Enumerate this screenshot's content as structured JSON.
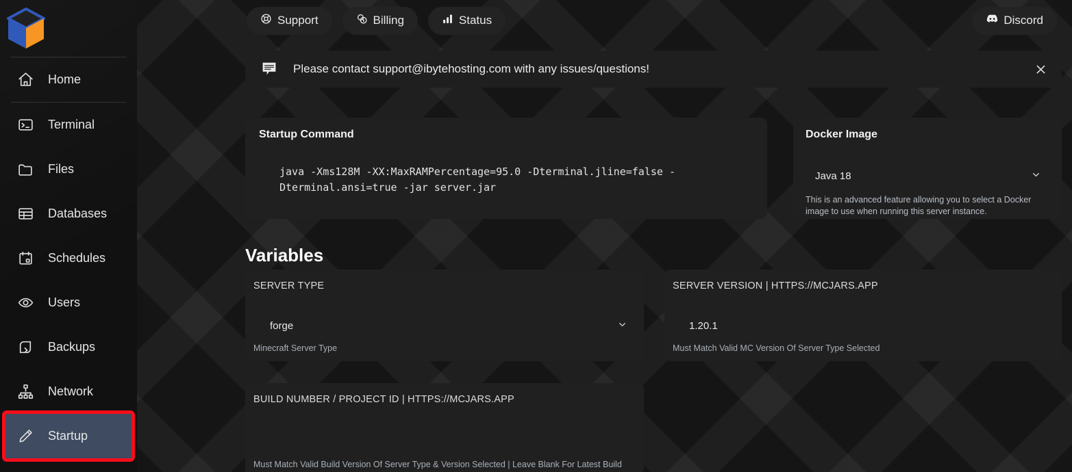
{
  "brand": {
    "logo_icon": "cube-logo-icon",
    "logo_colors": {
      "left": "#2b56b8",
      "right": "#f7941d",
      "top": "#1b1b1b"
    }
  },
  "sidebar": {
    "items": [
      {
        "label": "Home",
        "icon": "home-icon",
        "key": "home",
        "active": false
      },
      {
        "label": "Terminal",
        "icon": "terminal-icon",
        "key": "terminal",
        "active": false
      },
      {
        "label": "Files",
        "icon": "folder-icon",
        "key": "files",
        "active": false
      },
      {
        "label": "Databases",
        "icon": "database-icon",
        "key": "databases",
        "active": false
      },
      {
        "label": "Schedules",
        "icon": "calendar-icon",
        "key": "schedules",
        "active": false
      },
      {
        "label": "Users",
        "icon": "eye-icon",
        "key": "users",
        "active": false
      },
      {
        "label": "Backups",
        "icon": "backup-icon",
        "key": "backups",
        "active": false
      },
      {
        "label": "Network",
        "icon": "network-icon",
        "key": "network",
        "active": false
      },
      {
        "label": "Startup",
        "icon": "pencil-icon",
        "key": "startup",
        "active": true
      }
    ]
  },
  "topbar": {
    "support_label": "Support",
    "billing_label": "Billing",
    "status_label": "Status",
    "discord_label": "Discord",
    "support_icon": "lifebuoy-icon",
    "billing_icon": "coins-icon",
    "status_icon": "bar-chart-icon",
    "discord_icon": "discord-icon"
  },
  "banner": {
    "icon": "speech-bubble-icon",
    "message": "Please contact support@ibytehosting.com with any issues/questions!",
    "close_icon": "close-icon"
  },
  "startup_command": {
    "title": "Startup Command",
    "command": "java -Xms128M -XX:MaxRAMPercentage=95.0 -Dterminal.jline=false -Dterminal.ansi=true -jar server.jar"
  },
  "docker_image": {
    "title": "Docker Image",
    "selected": "Java 18",
    "chevron_icon": "chevron-down-icon",
    "description": "This is an advanced feature allowing you to select a Docker image to use when running this server instance."
  },
  "variables": {
    "heading": "Variables",
    "items": [
      {
        "label": "SERVER TYPE",
        "value": "forge",
        "hint": "Minecraft Server Type",
        "control": "select",
        "chevron_icon": "chevron-down-icon"
      },
      {
        "label": "SERVER VERSION | HTTPS://MCJARS.APP",
        "value": "1.20.1",
        "hint": "Must Match Valid MC Version Of Server Type Selected",
        "control": "text"
      },
      {
        "label": "BUILD NUMBER / PROJECT ID | HTTPS://MCJARS.APP",
        "value": "",
        "hint": "Must Match Valid Build Version Of Server Type & Version Selected |  Leave Blank For Latest Build",
        "control": "text"
      }
    ]
  },
  "annotation": {
    "target": "startup",
    "color": "#fc0d1b"
  }
}
